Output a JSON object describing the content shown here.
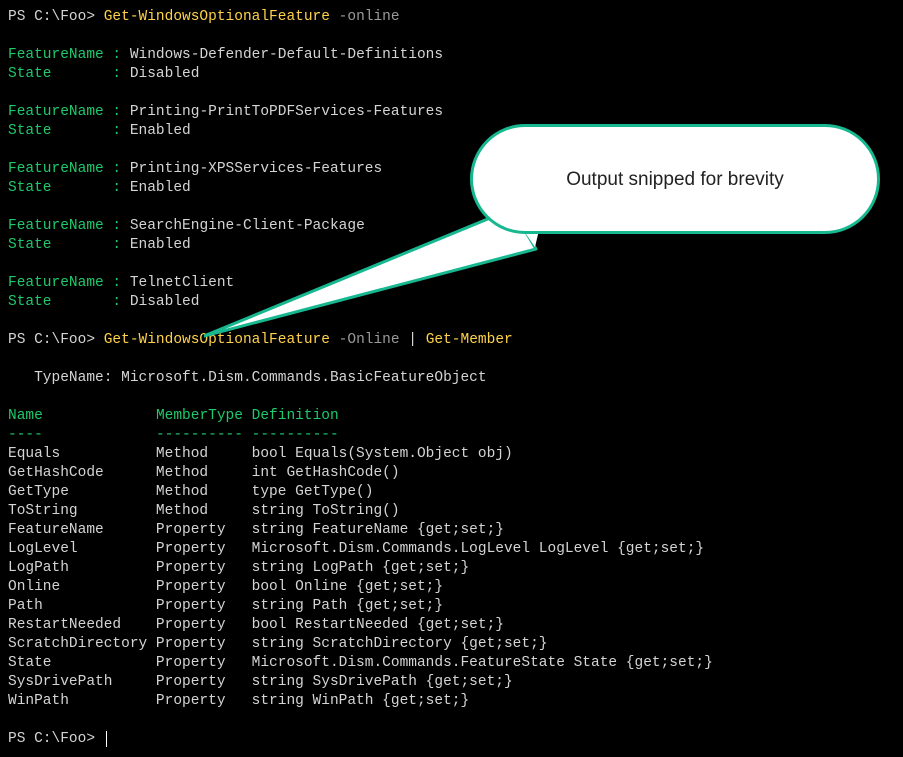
{
  "prompt": "PS C:\\Foo> ",
  "cmd1": {
    "name": "Get-WindowsOptionalFeature",
    "param": " -online"
  },
  "features": [
    {
      "name": "Windows-Defender-Default-Definitions",
      "state": "Disabled"
    },
    {
      "name": "Printing-PrintToPDFServices-Features",
      "state": "Enabled"
    },
    {
      "name": "Printing-XPSServices-Features",
      "state": "Enabled"
    },
    {
      "name": "SearchEngine-Client-Package",
      "state": "Enabled"
    },
    {
      "name": "TelnetClient",
      "state": "Disabled"
    }
  ],
  "labels": {
    "FeatureName": "FeatureName : ",
    "State": "State       : "
  },
  "cmd2": {
    "name": "Get-WindowsOptionalFeature",
    "param": " -Online",
    "pipe": " | ",
    "name2": "Get-Member"
  },
  "typename_label": "   TypeName: ",
  "typename": "Microsoft.Dism.Commands.BasicFeatureObject",
  "headers": {
    "Name": "Name",
    "MemberType": "MemberType",
    "Definition": "Definition"
  },
  "header_underline": {
    "Name": "----",
    "MemberType": "----------",
    "Definition": "----------"
  },
  "cols": {
    "name_w": 17,
    "type_w": 11
  },
  "members": [
    {
      "name": "Equals",
      "type": "Method",
      "def": "bool Equals(System.Object obj)"
    },
    {
      "name": "GetHashCode",
      "type": "Method",
      "def": "int GetHashCode()"
    },
    {
      "name": "GetType",
      "type": "Method",
      "def": "type GetType()"
    },
    {
      "name": "ToString",
      "type": "Method",
      "def": "string ToString()"
    },
    {
      "name": "FeatureName",
      "type": "Property",
      "def": "string FeatureName {get;set;}"
    },
    {
      "name": "LogLevel",
      "type": "Property",
      "def": "Microsoft.Dism.Commands.LogLevel LogLevel {get;set;}"
    },
    {
      "name": "LogPath",
      "type": "Property",
      "def": "string LogPath {get;set;}"
    },
    {
      "name": "Online",
      "type": "Property",
      "def": "bool Online {get;set;}"
    },
    {
      "name": "Path",
      "type": "Property",
      "def": "string Path {get;set;}"
    },
    {
      "name": "RestartNeeded",
      "type": "Property",
      "def": "bool RestartNeeded {get;set;}"
    },
    {
      "name": "ScratchDirectory",
      "type": "Property",
      "def": "string ScratchDirectory {get;set;}"
    },
    {
      "name": "State",
      "type": "Property",
      "def": "Microsoft.Dism.Commands.FeatureState State {get;set;}"
    },
    {
      "name": "SysDrivePath",
      "type": "Property",
      "def": "string SysDrivePath {get;set;}"
    },
    {
      "name": "WinPath",
      "type": "Property",
      "def": "string WinPath {get;set;}"
    }
  ],
  "callout": "Output snipped for brevity"
}
